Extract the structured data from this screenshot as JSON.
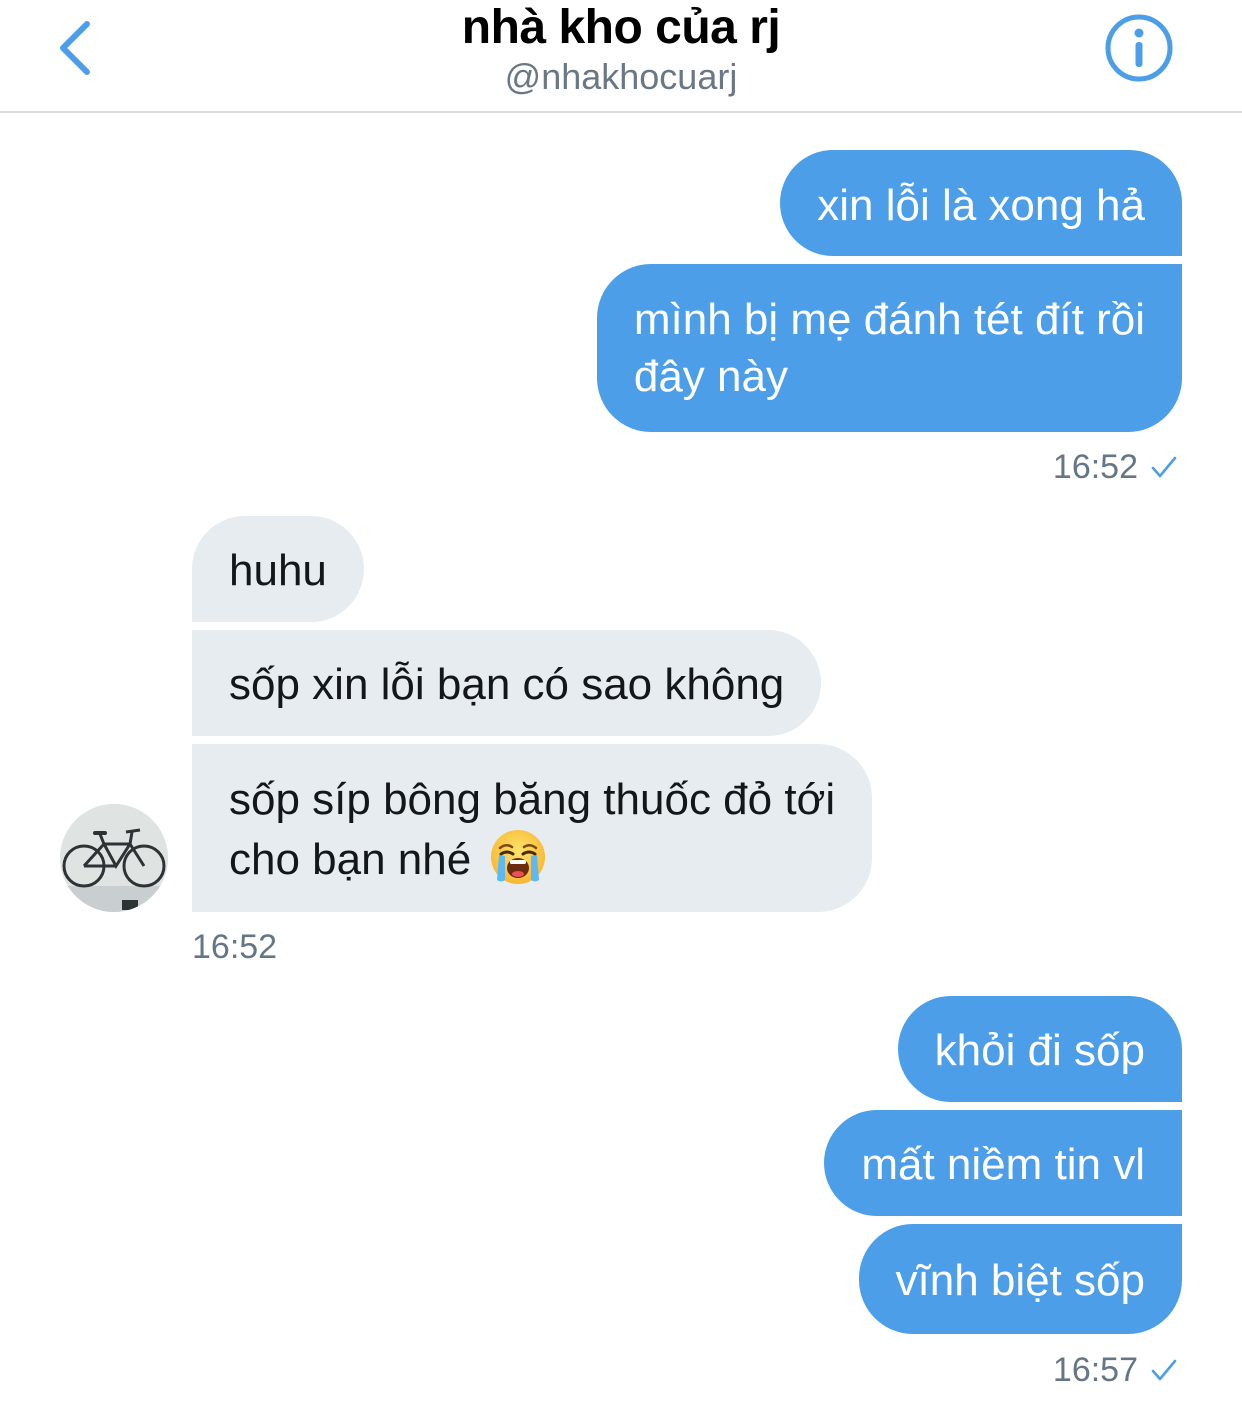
{
  "header": {
    "title": "nhà kho của rj",
    "handle": "@nhakhocuarj"
  },
  "conversation": {
    "group1": {
      "messages": [
        "xin lỗi là xong hả",
        "mình bị mẹ đánh tét đít rồi",
        "đây này"
      ],
      "time": "16:52"
    },
    "group2": {
      "messages": [
        "huhu",
        "sốp xin lỗi bạn có sao không",
        "sốp síp bông băng thuốc đỏ tới",
        "cho bạn nhé"
      ],
      "emoji": "loudly-crying-face",
      "time": "16:52"
    },
    "group3": {
      "messages": [
        "khỏi đi sốp",
        "mất niềm tin vl",
        "vĩnh biệt sốp"
      ],
      "time": "16:57"
    }
  },
  "colors": {
    "outgoing_bubble": "#4d9ee8",
    "incoming_bubble": "#e6ecf0",
    "accent": "#4d9ee8",
    "timestamp": "#657786"
  }
}
